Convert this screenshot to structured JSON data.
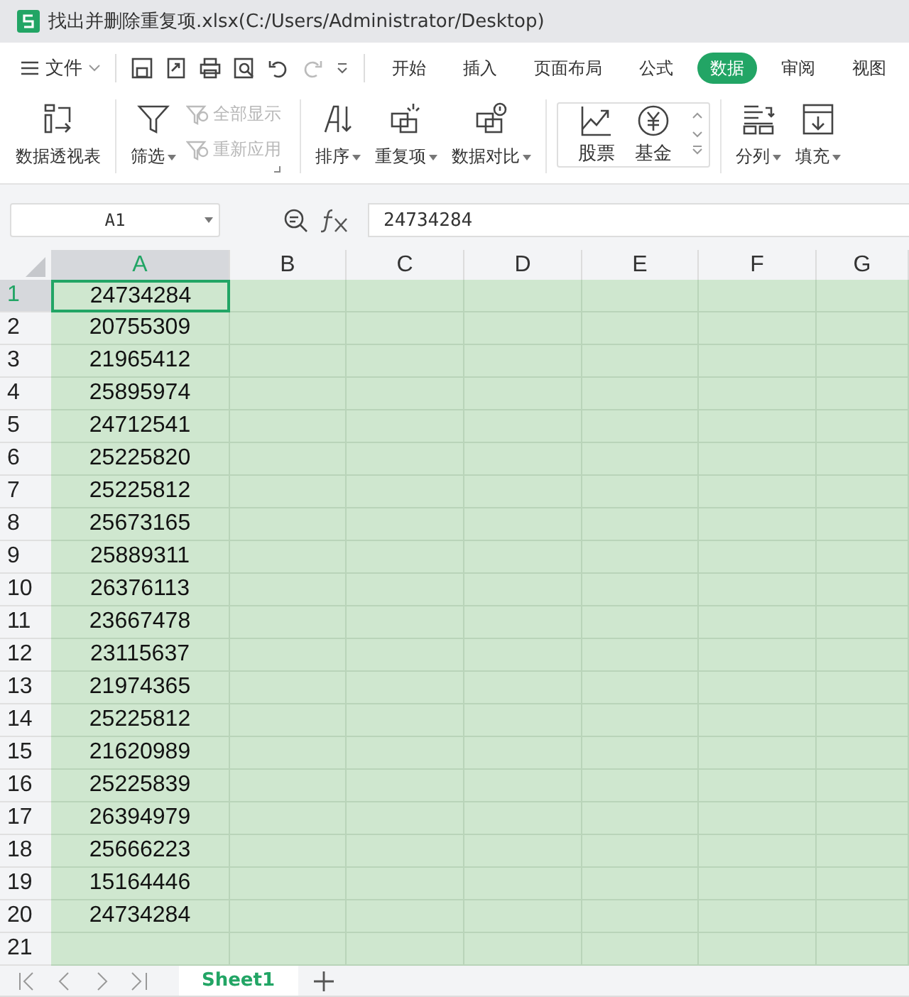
{
  "window": {
    "title": "找出并删除重复项.xlsx(C:/Users/Administrator/Desktop)"
  },
  "menu": {
    "file": "文件",
    "tabs": [
      {
        "label": "开始",
        "selected": false
      },
      {
        "label": "插入",
        "selected": false
      },
      {
        "label": "页面布局",
        "selected": false
      },
      {
        "label": "公式",
        "selected": false
      },
      {
        "label": "数据",
        "selected": true
      },
      {
        "label": "审阅",
        "selected": false
      },
      {
        "label": "视图",
        "selected": false
      }
    ]
  },
  "ribbon": [
    {
      "kind": "large",
      "label": "数据透视表",
      "dropdown": false
    },
    {
      "kind": "large",
      "label": "筛选",
      "dropdown": true
    },
    {
      "kind": "small",
      "items": [
        {
          "label": "全部显示",
          "disabled": true
        },
        {
          "label": "重新应用",
          "disabled": true
        }
      ]
    },
    {
      "kind": "large",
      "label": "排序",
      "dropdown": true
    },
    {
      "kind": "large",
      "label": "重复项",
      "dropdown": true
    },
    {
      "kind": "large",
      "label": "数据对比",
      "dropdown": true
    },
    {
      "kind": "gallery",
      "items": [
        {
          "label": "股票"
        },
        {
          "label": "基金"
        }
      ]
    },
    {
      "kind": "large",
      "label": "分列",
      "dropdown": true
    },
    {
      "kind": "large",
      "label": "填充",
      "dropdown": true
    }
  ],
  "formula_bar": {
    "name_box": "A1",
    "formula": "24734284"
  },
  "sheet": {
    "columns": [
      {
        "label": "A",
        "selected": true
      },
      {
        "label": "B",
        "selected": false
      },
      {
        "label": "C",
        "selected": false
      },
      {
        "label": "D",
        "selected": false
      },
      {
        "label": "E",
        "selected": false
      },
      {
        "label": "F",
        "selected": false
      },
      {
        "label": "G",
        "selected": false
      }
    ],
    "rows": [
      {
        "number": "1",
        "selected": true,
        "a": "24734284"
      },
      {
        "number": "2",
        "selected": false,
        "a": "20755309"
      },
      {
        "number": "3",
        "selected": false,
        "a": "21965412"
      },
      {
        "number": "4",
        "selected": false,
        "a": "25895974"
      },
      {
        "number": "5",
        "selected": false,
        "a": "24712541"
      },
      {
        "number": "6",
        "selected": false,
        "a": "25225820"
      },
      {
        "number": "7",
        "selected": false,
        "a": "25225812"
      },
      {
        "number": "8",
        "selected": false,
        "a": "25673165"
      },
      {
        "number": "9",
        "selected": false,
        "a": "25889311"
      },
      {
        "number": "10",
        "selected": false,
        "a": "26376113"
      },
      {
        "number": "11",
        "selected": false,
        "a": "23667478"
      },
      {
        "number": "12",
        "selected": false,
        "a": "23115637"
      },
      {
        "number": "13",
        "selected": false,
        "a": "21974365"
      },
      {
        "number": "14",
        "selected": false,
        "a": "25225812"
      },
      {
        "number": "15",
        "selected": false,
        "a": "21620989"
      },
      {
        "number": "16",
        "selected": false,
        "a": "25225839"
      },
      {
        "number": "17",
        "selected": false,
        "a": "26394979"
      },
      {
        "number": "18",
        "selected": false,
        "a": "25666223"
      },
      {
        "number": "19",
        "selected": false,
        "a": "15164446"
      },
      {
        "number": "20",
        "selected": false,
        "a": "24734284"
      },
      {
        "number": "21",
        "selected": false,
        "a": ""
      }
    ]
  },
  "sheet_tabs": [
    {
      "label": "Sheet1",
      "selected": true
    }
  ]
}
